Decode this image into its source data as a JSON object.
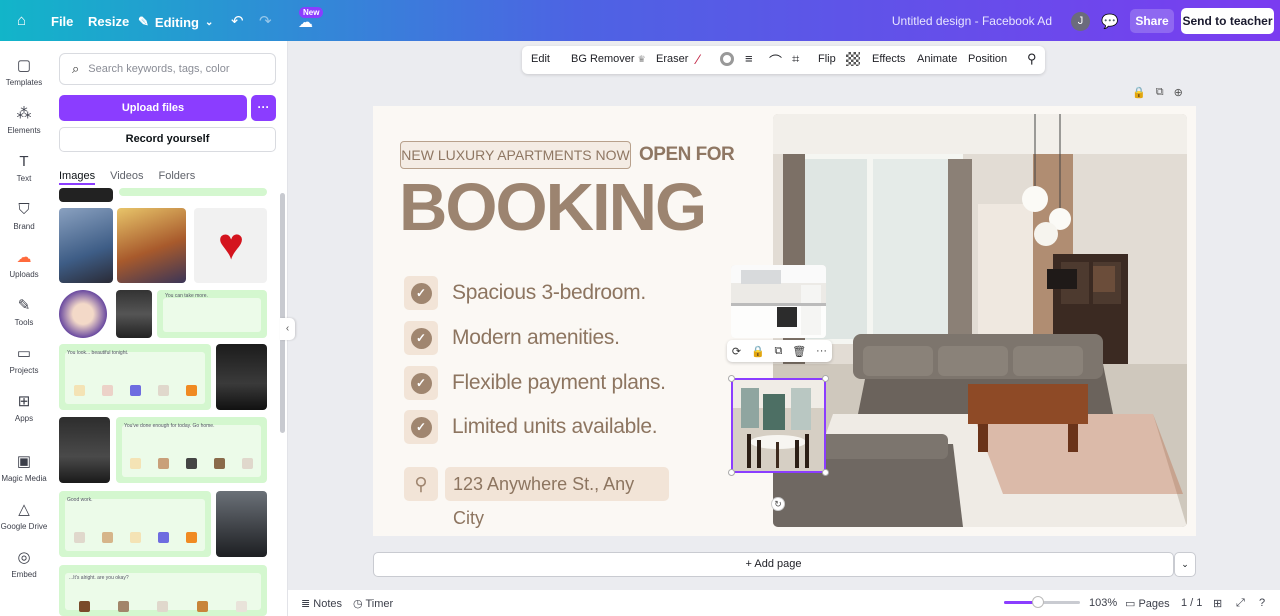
{
  "topbar": {
    "file_label": "File",
    "resize_label": "Resize",
    "editing_label": "Editing",
    "new_badge": "New",
    "doc_title": "Untitled design - Facebook Ad",
    "avatar_initial": "J",
    "share_label": "Share",
    "teacher_label": "Send to teacher",
    "gradient_colors": [
      "#12b5c9",
      "#4d63e3",
      "#7a3cf0"
    ]
  },
  "rail": [
    {
      "label": "Templates",
      "icon": "templates-icon"
    },
    {
      "label": "Elements",
      "icon": "elements-icon"
    },
    {
      "label": "Text",
      "icon": "text-icon"
    },
    {
      "label": "Brand",
      "icon": "brand-icon"
    },
    {
      "label": "Uploads",
      "icon": "uploads-icon"
    },
    {
      "label": "Tools",
      "icon": "tools-icon"
    },
    {
      "label": "Projects",
      "icon": "projects-icon"
    },
    {
      "label": "Apps",
      "icon": "apps-icon"
    },
    {
      "label": "Magic Media",
      "icon": "magic-media-icon"
    },
    {
      "label": "Google Drive",
      "icon": "google-drive-icon"
    },
    {
      "label": "Embed",
      "icon": "embed-icon"
    }
  ],
  "panel": {
    "search_placeholder": "Search keywords, tags, color",
    "upload_label": "Upload files",
    "record_label": "Record yourself",
    "tabs": [
      "Images",
      "Videos",
      "Folders"
    ],
    "thumb_texts": {
      "t1": "You can take more.",
      "t2": "You look... beautiful tonight.",
      "t3": "You've done enough for today. Go home.",
      "t4": "Good work.",
      "t5": "...It's alright. are you okay?"
    }
  },
  "toolbar": {
    "edit": "Edit",
    "bg_remover": "BG Remover",
    "eraser": "Eraser",
    "flip": "Flip",
    "effects": "Effects",
    "animate": "Animate",
    "position": "Position"
  },
  "design": {
    "badge": "NEW LUXURY APARTMENTS NOW",
    "open_for": "OPEN FOR",
    "headline": "BOOKING",
    "features": [
      "Spacious 3-bedroom.",
      "Modern amenities.",
      "Flexible payment plans.",
      "Limited units available."
    ],
    "address": "123 Anywhere St., Any City",
    "accent_color": "#9c8470"
  },
  "footer": {
    "add_page": "+ Add page",
    "notes": "Notes",
    "timer": "Timer",
    "zoom": "103%",
    "zoom_fraction": 0.45,
    "pages_label": "Pages",
    "page_count": "1 / 1"
  }
}
